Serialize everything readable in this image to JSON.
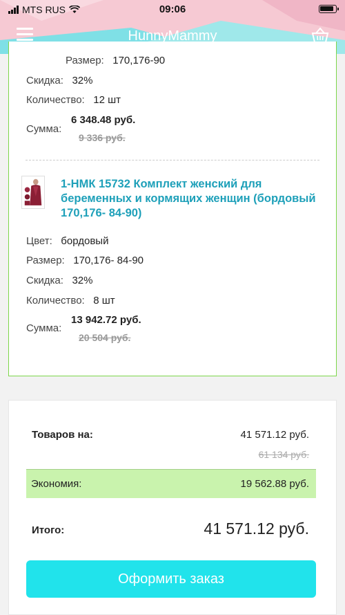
{
  "status_bar": {
    "carrier": "MTS RUS",
    "time": "09:06"
  },
  "header": {
    "title": "HunnyMammy",
    "menu_icon": "hamburger-menu-icon",
    "cart_icon": "basket-icon"
  },
  "item_prev": {
    "size_label": "Размер:",
    "size_value": "170,176-90",
    "discount_label": "Скидка:",
    "discount_value": "32%",
    "qty_label": "Количество:",
    "qty_value": "12 шт",
    "sum_label": "Сумма:",
    "sum_value": "6 348.48 руб.",
    "sum_old": "9 336 руб."
  },
  "item": {
    "title": "1-НМК 15732 Комплект женский для беременных и кормящих женщин (бордовый 170,176- 84-90)",
    "color_label": "Цвет:",
    "color_value": "бордовый",
    "size_label": "Размер:",
    "size_value": "170,176- 84-90",
    "discount_label": "Скидка:",
    "discount_value": "32%",
    "qty_label": "Количество:",
    "qty_value": "8 шт",
    "sum_label": "Сумма:",
    "sum_value": "13 942.72 руб.",
    "sum_old": "20 504 руб."
  },
  "summary": {
    "goods_label": "Товаров на:",
    "goods_value": "41 571.12 руб.",
    "goods_old": "61 134 руб.",
    "savings_label": "Экономия:",
    "savings_value": "19 562.88 руб.",
    "total_label": "Итого:",
    "total_value": "41 571.12 руб.",
    "checkout_label": "Оформить заказ"
  },
  "colors": {
    "accent_link": "#1ea0b9",
    "checkout_button": "#21e3eb",
    "savings_bg": "#c9f3ad",
    "card_border": "#7dd64a"
  }
}
